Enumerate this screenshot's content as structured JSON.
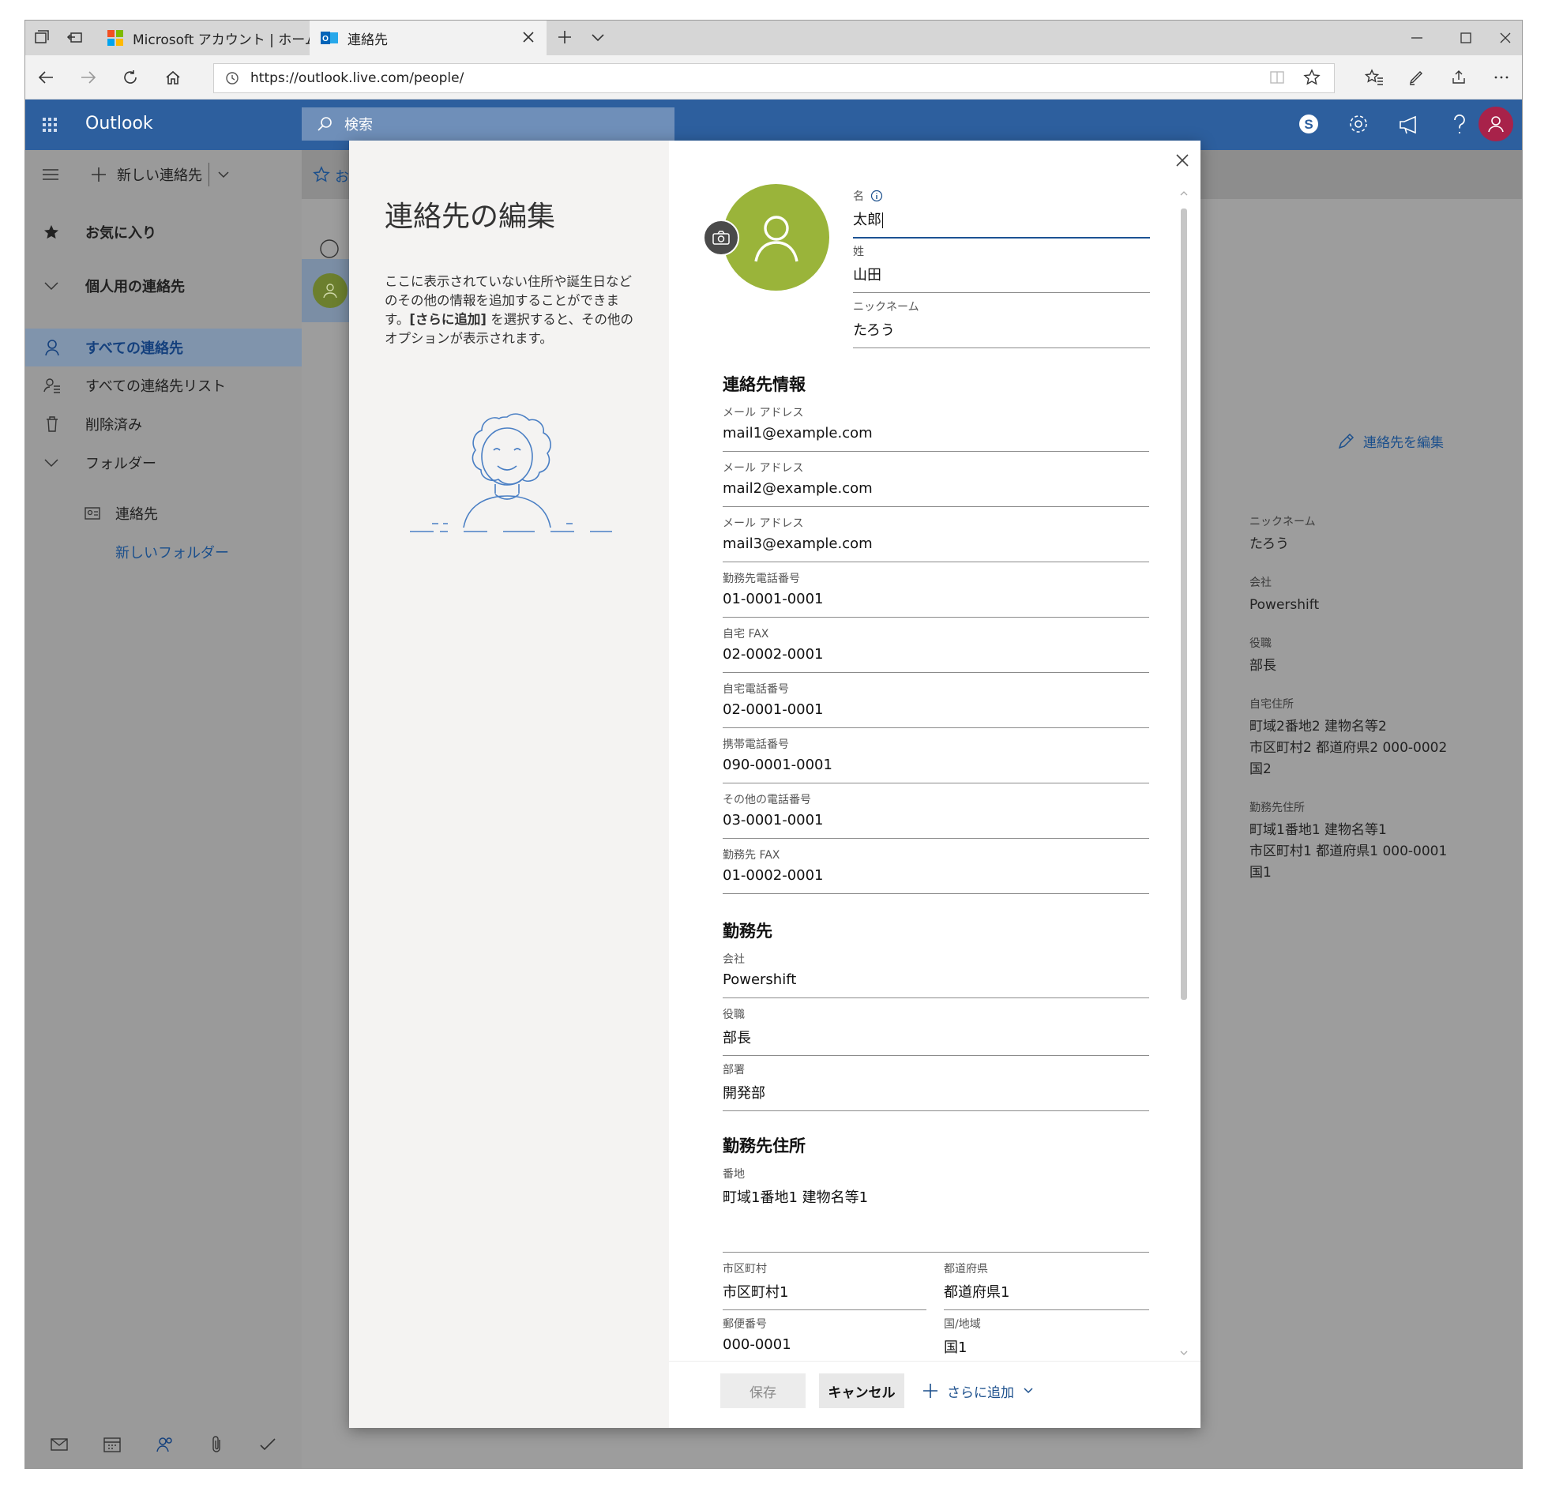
{
  "browser": {
    "tabs": [
      {
        "label": "Microsoft アカウント | ホーム"
      },
      {
        "label": "連絡先"
      }
    ],
    "url": "https://outlook.live.com/people/"
  },
  "outlook": {
    "app_name": "Outlook",
    "search_placeholder": "検索",
    "new_contact": "新しい連絡先",
    "nav": [
      {
        "label": "お気に入り"
      },
      {
        "label": "個人用の連絡先"
      },
      {
        "label": "すべての連絡先"
      },
      {
        "label": "すべての連絡先リスト"
      },
      {
        "label": "削除済み"
      },
      {
        "label": "フォルダー"
      },
      {
        "label": "連絡先"
      },
      {
        "label": "新しいフォルダー"
      }
    ],
    "favorites_partial": "お",
    "edit_contact_link": "連絡先を編集",
    "detail": [
      {
        "label": "ニックネーム",
        "value": "たろう"
      },
      {
        "label": "会社",
        "value": "Powershift"
      },
      {
        "label": "役職",
        "value": "部長"
      },
      {
        "label": "自宅住所",
        "value": "町域2番地2 建物名等2\n市区町村2 都道府県2 000-0002\n国2"
      },
      {
        "label": "勤務先住所",
        "value": "町域1番地1 建物名等1\n市区町村1 都道府県1 000-0001\n国1"
      }
    ]
  },
  "modal": {
    "title": "連絡先の編集",
    "description_1": "ここに表示されていない住所や誕生日などのその他の情報を追加することができます。",
    "description_bold": "[さらに追加]",
    "description_2": " を選択すると、その他のオプションが表示されます。",
    "name_fields": [
      {
        "label": "名",
        "value": "太郎"
      },
      {
        "label": "姓",
        "value": "山田"
      },
      {
        "label": "ニックネーム",
        "value": "たろう"
      }
    ],
    "sections": {
      "contact_info": "連絡先情報",
      "work": "勤務先",
      "work_address": "勤務先住所"
    },
    "contact_fields": [
      {
        "label": "メール アドレス",
        "value": "mail1@example.com"
      },
      {
        "label": "メール アドレス",
        "value": "mail2@example.com"
      },
      {
        "label": "メール アドレス",
        "value": "mail3@example.com"
      },
      {
        "label": "勤務先電話番号",
        "value": "01-0001-0001"
      },
      {
        "label": "自宅 FAX",
        "value": "02-0002-0001"
      },
      {
        "label": "自宅電話番号",
        "value": "02-0001-0001"
      },
      {
        "label": "携帯電話番号",
        "value": "090-0001-0001"
      },
      {
        "label": "その他の電話番号",
        "value": "03-0001-0001"
      },
      {
        "label": "勤務先 FAX",
        "value": "01-0002-0001"
      }
    ],
    "work_fields": [
      {
        "label": "会社",
        "value": "Powershift"
      },
      {
        "label": "役職",
        "value": "部長"
      },
      {
        "label": "部署",
        "value": "開発部"
      }
    ],
    "address_fields": {
      "street": {
        "label": "番地",
        "value": "町域1番地1 建物名等1"
      },
      "city": {
        "label": "市区町村",
        "value": "市区町村1"
      },
      "state": {
        "label": "都道府県",
        "value": "都道府県1"
      },
      "zip": {
        "label": "郵便番号",
        "value": "000-0001"
      },
      "country": {
        "label": "国/地域",
        "value": "国1"
      }
    },
    "buttons": {
      "save": "保存",
      "cancel": "キャンセル",
      "add_more": "さらに追加"
    }
  }
}
